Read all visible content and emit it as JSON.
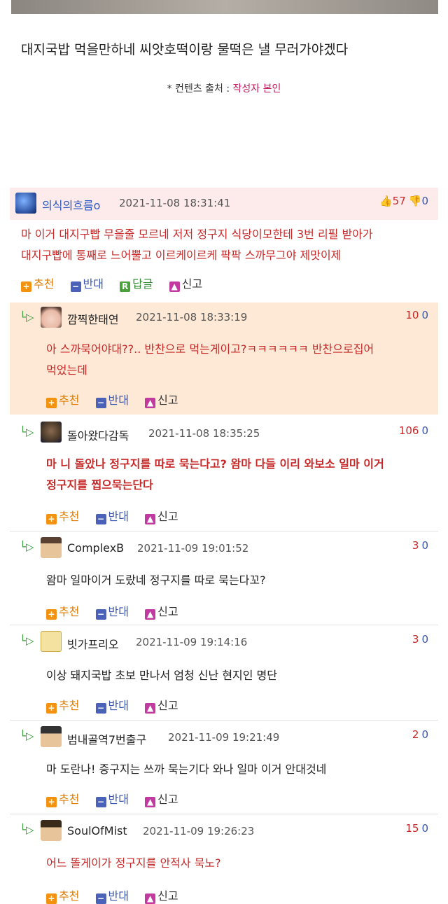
{
  "post": {
    "text": "대지국밥 먹을만하네 씨앗호떡이랑 물떡은 낼 무러가야겠다",
    "source_prefix": "* 컨텐츠 출처 : ",
    "source_author": "작성자 본인"
  },
  "actions": {
    "up": "추천",
    "down": "반대",
    "reply": "답글",
    "report": "신고"
  },
  "comments": [
    {
      "nick": "의식의흐름o",
      "date": "2021-11-08 18:31:41",
      "up": "57",
      "down": "0",
      "text_line1": "마 이거 대지구빱 무을줄 모르네 저저 정구지 식당이모한테 3번 리필 받아가",
      "text_line2": "대지구빱에 통째로 느어뿔고 이르케이르케 팍팍 스까무그야 제맛이제"
    },
    {
      "nick": "깜찍한태연",
      "date": "2021-11-08 18:33:19",
      "up": "10",
      "down": "0",
      "text_line1": "아 스까묵어야대??.. 반찬으로 먹는게이고?ㅋㅋㅋㅋㅋㅋ 반찬으로집어",
      "text_line2": "먹었는데"
    },
    {
      "nick": "돌아왔다감독",
      "date": "2021-11-08 18:35:25",
      "up": "106",
      "down": "0",
      "text_line1": "마 니 돌았나 정구지를 따로 묵는다고? 왐마 다들 이리 와보소 일마 이거",
      "text_line2": "정구지를 찝으묵는단다"
    },
    {
      "nick": "ComplexB",
      "date": "2021-11-09 19:01:52",
      "up": "3",
      "down": "0",
      "text_line1": "왐마 일마이거 도랐네 정구지를 따로 묵는다꼬?"
    },
    {
      "nick": "빗가프리오",
      "date": "2021-11-09 19:14:16",
      "up": "3",
      "down": "0",
      "text_line1": "이상 돼지국밥 초보 만나서 엄청 신난 현지인 명단"
    },
    {
      "nick": "범내골역7번출구",
      "date": "2021-11-09 19:21:49",
      "up": "2",
      "down": "0",
      "text_line1": "마 도란나! 증구지는 쓰까 묵는기다 와나 일마 이거 안대것네"
    },
    {
      "nick": "SoulOfMist",
      "date": "2021-11-09 19:26:23",
      "up": "15",
      "down": "0",
      "text_line1": "어느 똘게이가 정구지를 안적사 묵노?"
    }
  ]
}
